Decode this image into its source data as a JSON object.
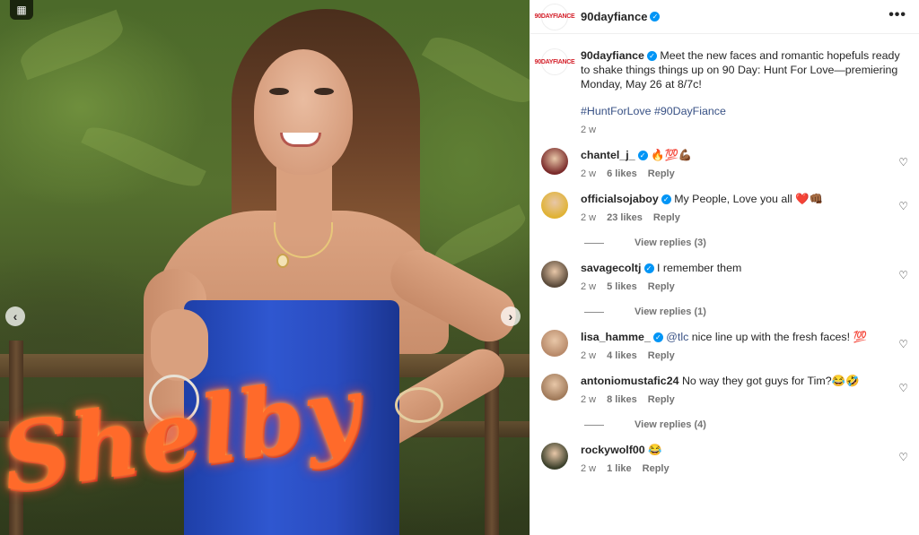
{
  "post": {
    "image_overlay_text": "Shelby"
  },
  "header": {
    "logo_text": "90DAYFIANCE",
    "username": "90dayfiance",
    "more_label": "•••"
  },
  "caption": {
    "username": "90dayfiance",
    "text": "Meet the new faces and romantic hopefuls ready to shake things things up on 90 Day: Hunt For Love—premiering Monday, May 26 at 8/7c!",
    "tags": "#HuntForLove #90DayFiance",
    "time": "2 w"
  },
  "comments": [
    {
      "username": "chantel_j_",
      "verified": true,
      "text": "🔥💯💪🏾",
      "time": "2 w",
      "likes": "6 likes",
      "reply": "Reply",
      "view_replies": "",
      "avatar_color": "#7a2a2a"
    },
    {
      "username": "officialsojaboy",
      "verified": true,
      "text": "My People, Love you all ❤️👊🏾",
      "time": "2 w",
      "likes": "23 likes",
      "reply": "Reply",
      "view_replies": "View replies (3)",
      "avatar_color": "#e0b233"
    },
    {
      "username": "savagecoltj",
      "verified": true,
      "text": "I remember them",
      "time": "2 w",
      "likes": "5 likes",
      "reply": "Reply",
      "view_replies": "View replies (1)",
      "avatar_color": "#5a4a3a"
    },
    {
      "username": "lisa_hamme_",
      "verified": true,
      "mention": "@tlc",
      "text": "nice line up with the fresh faces! 💯",
      "time": "2 w",
      "likes": "4 likes",
      "reply": "Reply",
      "view_replies": "",
      "avatar_color": "#b88a6a"
    },
    {
      "username": "antoniomustafic24",
      "verified": false,
      "text": "No way they got guys for Tim?😂🤣",
      "time": "2 w",
      "likes": "8 likes",
      "reply": "Reply",
      "view_replies": "View replies (4)",
      "avatar_color": "#a07a5a"
    },
    {
      "username": "rockywolf00",
      "verified": false,
      "text": "😂",
      "time": "2 w",
      "likes": "1 like",
      "reply": "Reply",
      "view_replies": "",
      "avatar_color": "#3a3f2a"
    }
  ],
  "colors": {
    "link": "#385185",
    "verified": "#0095f6",
    "muted": "#737373"
  }
}
